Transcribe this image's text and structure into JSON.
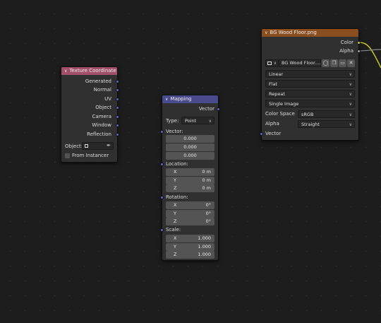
{
  "colors": {
    "texture_coordinate_header": "#a24f6a",
    "mapping_header": "#4a4b8d",
    "image_texture_header": "#8b4e1e",
    "vector_socket": "#6363c7",
    "color_socket": "#c7c729",
    "gray_socket": "#a1a1a1",
    "link": "#c7c729"
  },
  "texture_coordinate": {
    "title": "Texture Coordinate",
    "outputs": [
      "Generated",
      "Normal",
      "UV",
      "Object",
      "Camera",
      "Window",
      "Reflection"
    ],
    "object_label": "Object:",
    "from_instancer_label": "From Instancer"
  },
  "mapping": {
    "title": "Mapping",
    "output_label": "Vector",
    "type_label": "Type:",
    "type_value": "Point",
    "vector_label": "Vector:",
    "vector_values": [
      "0.000",
      "0.000",
      "0.000"
    ],
    "location_label": "Location:",
    "location": [
      {
        "axis": "X",
        "value": "0 m"
      },
      {
        "axis": "Y",
        "value": "0 m"
      },
      {
        "axis": "Z",
        "value": "0 m"
      }
    ],
    "rotation_label": "Rotation:",
    "rotation": [
      {
        "axis": "X",
        "value": "0°"
      },
      {
        "axis": "Y",
        "value": "0°"
      },
      {
        "axis": "Z",
        "value": "0°"
      }
    ],
    "scale_label": "Scale:",
    "scale": [
      {
        "axis": "X",
        "value": "1.000"
      },
      {
        "axis": "Y",
        "value": "1.000"
      },
      {
        "axis": "Z",
        "value": "1.000"
      }
    ]
  },
  "image_texture": {
    "title": "BG Wood Floor.png",
    "outputs": [
      "Color",
      "Alpha"
    ],
    "image_name": "BG Wood Floor....",
    "interpolation": "Linear",
    "projection": "Flat",
    "extension": "Repeat",
    "source": "Single Image",
    "color_space_label": "Color Space",
    "color_space_value": "sRGB",
    "alpha_label": "Alpha",
    "alpha_value": "Straight",
    "input_label": "Vector"
  }
}
